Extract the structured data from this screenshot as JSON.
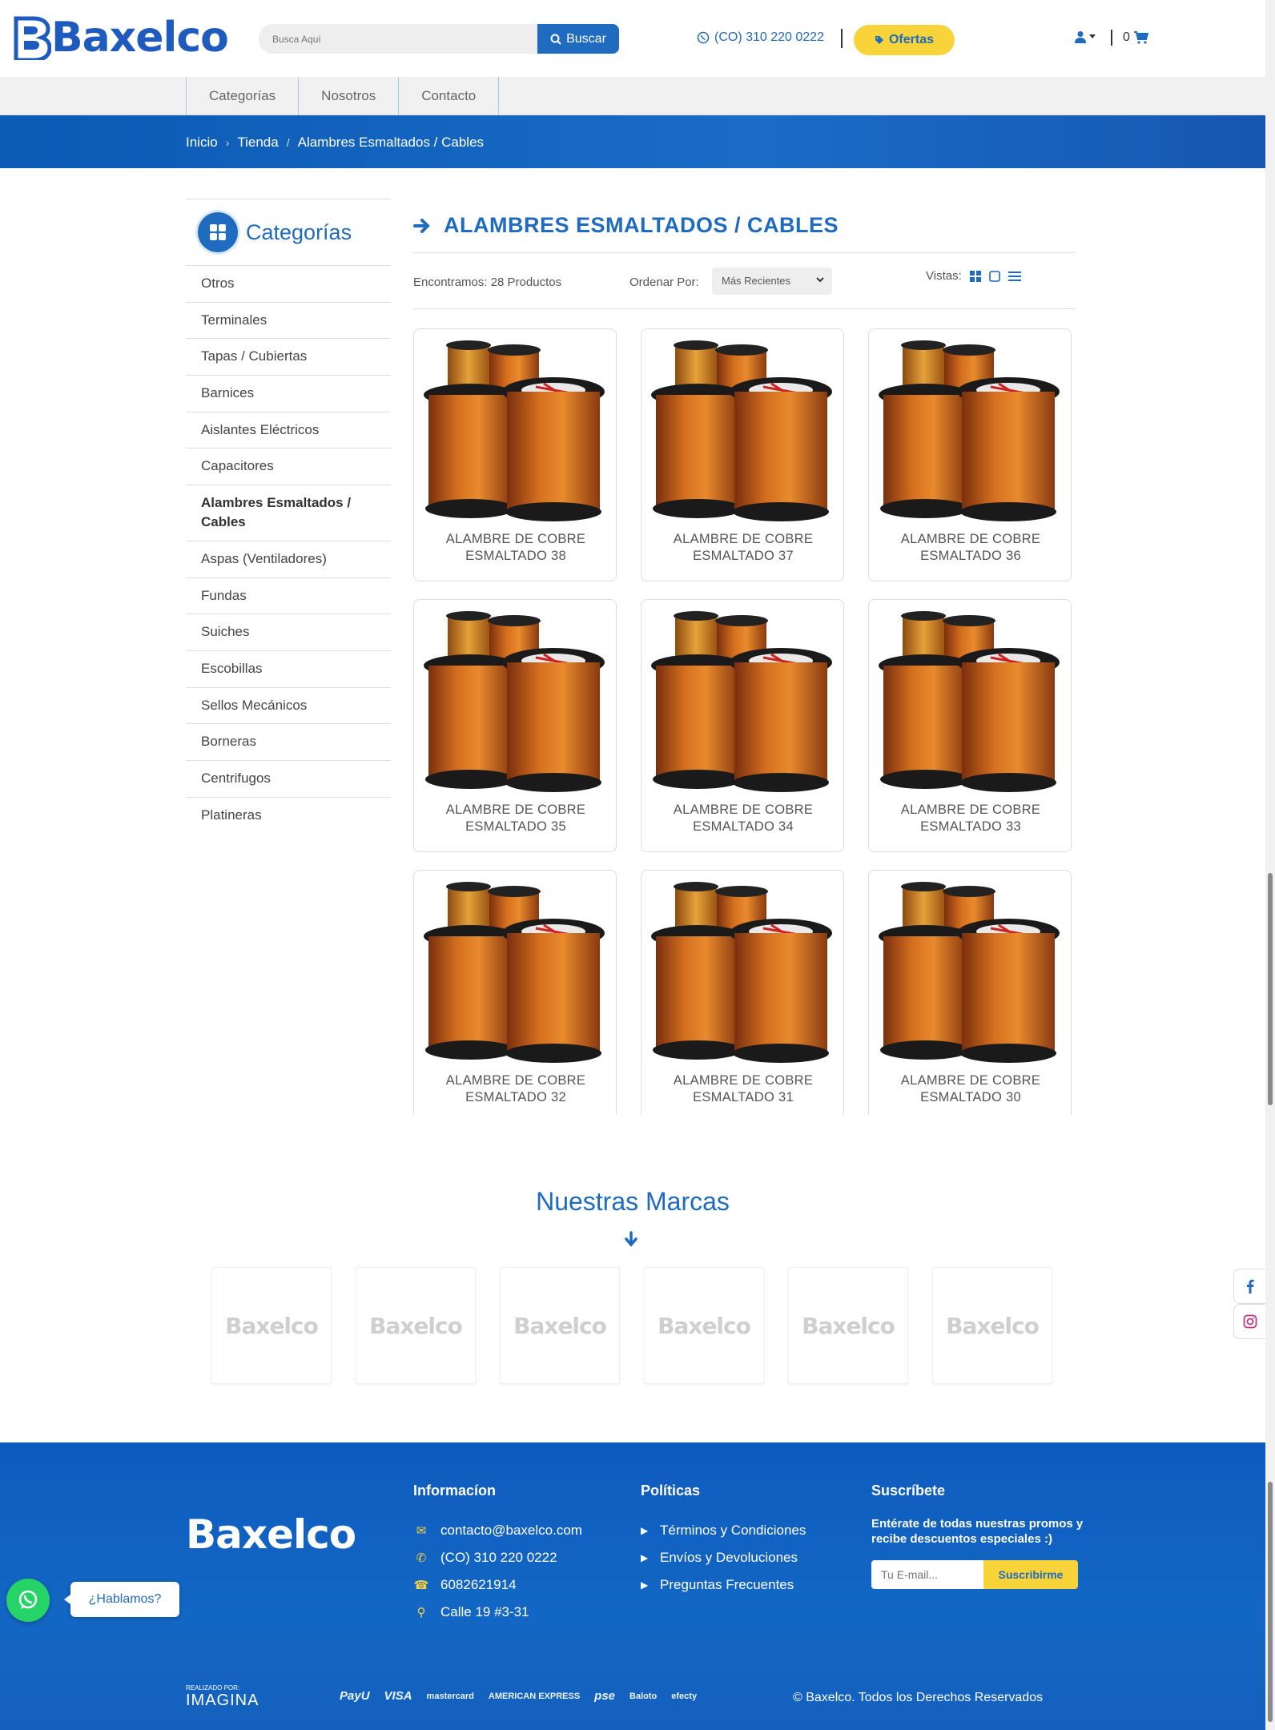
{
  "brand": {
    "logo_text": "Baxelco"
  },
  "header": {
    "search_placeholder": "Busca Aquí",
    "search_button": "Buscar",
    "phone": "(CO) 310 220 0222",
    "ofertas": "Ofertas",
    "cart_count": "0"
  },
  "nav": {
    "items": [
      "Categorías",
      "Nosotros",
      "Contacto"
    ]
  },
  "breadcrumb": {
    "items": [
      "Inicio",
      "Tienda",
      "Alambres Esmaltados / Cables"
    ]
  },
  "sidebar": {
    "title": "Categorías",
    "items": [
      "Otros",
      "Terminales",
      "Tapas / Cubiertas",
      "Barnices",
      "Aislantes Eléctricos",
      "Capacitores",
      "Alambres Esmaltados / Cables",
      "Aspas (Ventiladores)",
      "Fundas",
      "Suiches",
      "Escobillas",
      "Sellos Mecánicos",
      "Borneras",
      "Centrifugos",
      "Platineras"
    ],
    "active_index": 6
  },
  "main": {
    "title": "ALAMBRES ESMALTADOS / CABLES",
    "found": "Encontramos: 28 Productos",
    "sort_label": "Ordenar Por:",
    "sort_value": "Más Recientes",
    "views_label": "Vistas:"
  },
  "products": [
    {
      "name_line1": "ALAMBRE DE COBRE",
      "name_line2": "ESMALTADO 38"
    },
    {
      "name_line1": "ALAMBRE DE COBRE",
      "name_line2": "ESMALTADO 37"
    },
    {
      "name_line1": "ALAMBRE DE COBRE",
      "name_line2": "ESMALTADO 36"
    },
    {
      "name_line1": "ALAMBRE DE COBRE",
      "name_line2": "ESMALTADO 35"
    },
    {
      "name_line1": "ALAMBRE DE COBRE",
      "name_line2": "ESMALTADO 34"
    },
    {
      "name_line1": "ALAMBRE DE COBRE",
      "name_line2": "ESMALTADO 33"
    },
    {
      "name_line1": "ALAMBRE DE COBRE",
      "name_line2": "ESMALTADO 32"
    },
    {
      "name_line1": "ALAMBRE DE COBRE",
      "name_line2": "ESMALTADO 31"
    },
    {
      "name_line1": "ALAMBRE DE COBRE",
      "name_line2": "ESMALTADO 30"
    }
  ],
  "brands": {
    "title": "Nuestras Marcas",
    "logos": [
      "Baxelco",
      "Baxelco",
      "Baxelco",
      "Baxelco",
      "Baxelco",
      "Baxelco"
    ]
  },
  "footer": {
    "logo": "Baxelco",
    "info_title": "Informacíon",
    "info": [
      "contacto@baxelco.com",
      "(CO) 310 220 0222",
      "6082621914",
      "Calle 19 #3-31"
    ],
    "policies_title": "Políticas",
    "policies": [
      "Términos y Condiciones",
      "Envíos y Devoluciones",
      "Preguntas Frecuentes"
    ],
    "subscribe_title": "Suscríbete",
    "subscribe_text": "Entérate de todas nuestras promos y recibe descuentos especiales :)",
    "subscribe_placeholder": "Tu E-mail...",
    "subscribe_button": "Suscribirme",
    "made_by_small": "REALIZADO POR:",
    "made_by": "IMAGINA",
    "payments": [
      "PayU",
      "VISA",
      "mastercard",
      "AMERICAN EXPRESS",
      "pse",
      "Baloto",
      "efecty"
    ],
    "copyright": "© Baxelco. Todos los Derechos Reservados"
  },
  "whatsapp": {
    "label": "¿Hablamos?"
  },
  "colors": {
    "primary": "#1e6bbf",
    "accent": "#f8d33a",
    "whatsapp": "#25d366"
  }
}
